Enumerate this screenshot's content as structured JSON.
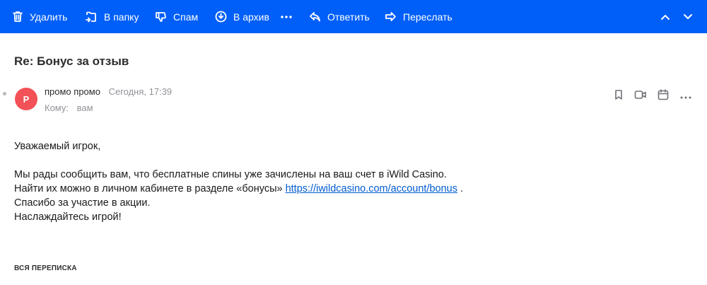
{
  "toolbar": {
    "delete_label": "Удалить",
    "folder_label": "В папку",
    "spam_label": "Спам",
    "archive_label": "В архив",
    "reply_label": "Ответить",
    "forward_label": "Переслать",
    "background_color": "#005ff9",
    "icons": [
      "trash-icon",
      "folder-move-icon",
      "thumbs-down-icon",
      "archive-icon",
      "more-icon",
      "reply-icon",
      "forward-icon",
      "chevron-up-icon",
      "chevron-down-icon"
    ]
  },
  "message": {
    "subject": "Re: Бонус за отзыв",
    "avatar_letter": "P",
    "avatar_color": "#f25157",
    "sender_name": "промо промо",
    "date": "Сегодня, 17:39",
    "to_label": "Кому:",
    "to_value": "вам",
    "action_icons": [
      "bookmark-icon",
      "video-call-icon",
      "calendar-icon",
      "more-icon"
    ]
  },
  "body": {
    "greeting": "Уважаемый игрок,",
    "line1": "Мы рады сообщить вам, что бесплатные спины уже зачислены на ваш счет в iWild Casino.",
    "line2_prefix": "Найти их можно в личном кабинете в разделе «бонусы» ",
    "line2_link": "https://iwildcasino.com/account/bonus",
    "line2_suffix": " .",
    "line3": "Спасибо за участие в акции.",
    "line4": "Наслаждайтесь игрой!",
    "link_color": "#005bd1"
  },
  "thread": {
    "label": "ВСЯ ПЕРЕПИСКА"
  }
}
